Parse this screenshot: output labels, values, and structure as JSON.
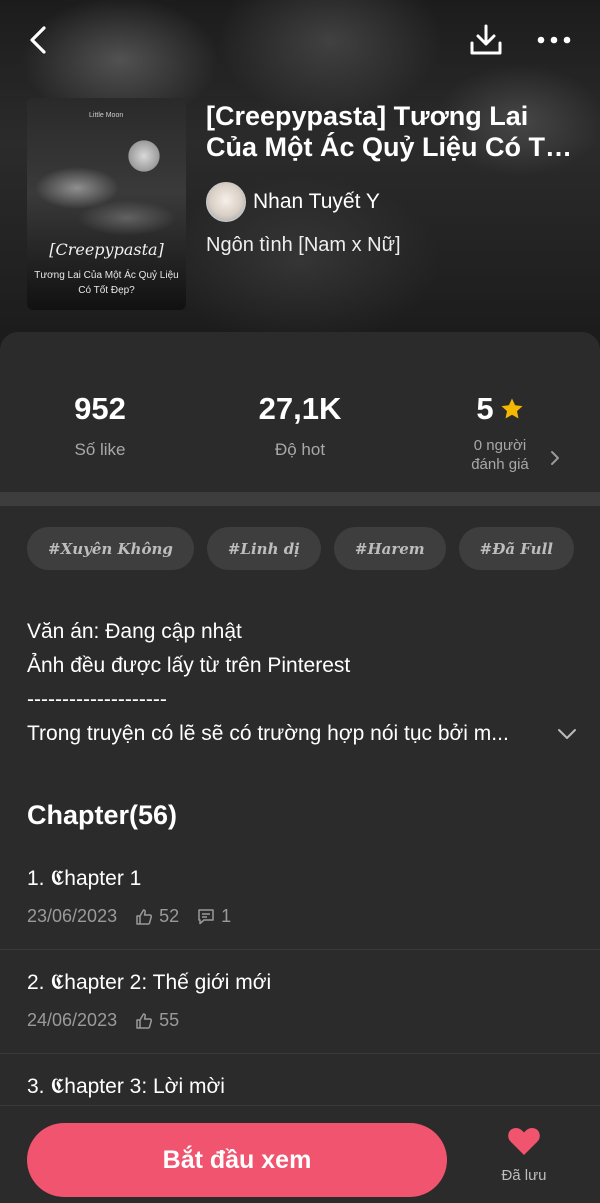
{
  "book": {
    "title": "[Creepypasta] Tương Lai Của Một Ác Quỷ Liệu Có Tốt Đẹp?",
    "author": "Nhan Tuyết Y",
    "genre": "Ngôn tình [Nam x Nữ]",
    "cover": {
      "small_text": "Little Moon",
      "title": "[Creepypasta]",
      "subtitle": "Tương Lai Của Một Ác Quỷ Liệu Có Tốt Đẹp?"
    }
  },
  "stats": {
    "likes": {
      "value": "952",
      "label": "Số like"
    },
    "hot": {
      "value": "27,1K",
      "label": "Độ hot"
    },
    "rating": {
      "value": "5",
      "sub1": "0 người",
      "sub2": "đánh giá"
    }
  },
  "tags": [
    "#Xuyên Không",
    "#Linh dị",
    "#Harem",
    "#Đã Full"
  ],
  "description": {
    "line1": "Văn án: Đang cập nhật",
    "line2": "Ảnh đều được lấy từ trên Pinterest",
    "divider": "--------------------",
    "line3": "Trong truyện có lẽ sẽ có trường hợp nói tục bởi m..."
  },
  "chapters_header": "Chapter(56)",
  "chapters": [
    {
      "title": "1. 𝕮hapter 1",
      "date": "23/06/2023",
      "likes": "52",
      "comments": "1"
    },
    {
      "title": "2. 𝕮hapter 2: Thế giới mới",
      "date": "24/06/2023",
      "likes": "55",
      "comments": ""
    },
    {
      "title": "3. 𝕮hapter 3: Lời mời",
      "date": "",
      "likes": "",
      "comments": ""
    }
  ],
  "actions": {
    "start": "Bắt đầu xem",
    "saved": "Đã lưu"
  },
  "colors": {
    "accent": "#f0546e",
    "star": "#f5b800",
    "background": "#2b2b2b"
  },
  "icons": [
    "back-icon",
    "download-icon",
    "more-icon",
    "star-icon",
    "chevron-right-icon",
    "chevron-down-icon",
    "thumb-up-icon",
    "comment-icon",
    "heart-icon"
  ]
}
